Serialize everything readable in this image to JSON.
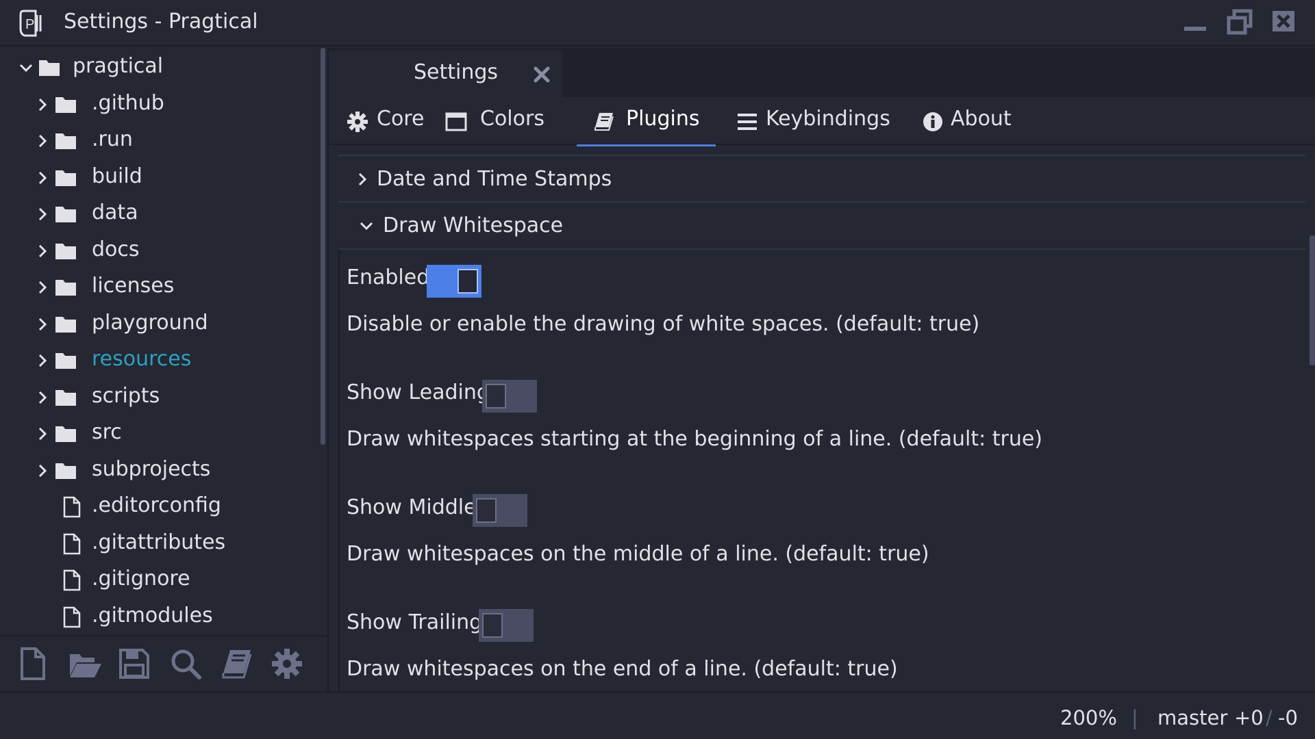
{
  "window": {
    "title": "Settings - Pragtical",
    "logo_text": "P"
  },
  "sidebar": {
    "tree": [
      {
        "label": "pragtical",
        "type": "folder",
        "expanded": true,
        "depth": 0
      },
      {
        "label": ".github",
        "type": "folder",
        "expanded": false,
        "depth": 1
      },
      {
        "label": ".run",
        "type": "folder",
        "expanded": false,
        "depth": 1
      },
      {
        "label": "build",
        "type": "folder",
        "expanded": false,
        "depth": 1
      },
      {
        "label": "data",
        "type": "folder",
        "expanded": false,
        "depth": 1
      },
      {
        "label": "docs",
        "type": "folder",
        "expanded": false,
        "depth": 1
      },
      {
        "label": "licenses",
        "type": "folder",
        "expanded": false,
        "depth": 1
      },
      {
        "label": "playground",
        "type": "folder",
        "expanded": false,
        "depth": 1
      },
      {
        "label": "resources",
        "type": "folder",
        "expanded": false,
        "depth": 1,
        "highlight": true
      },
      {
        "label": "scripts",
        "type": "folder",
        "expanded": false,
        "depth": 1
      },
      {
        "label": "src",
        "type": "folder",
        "expanded": false,
        "depth": 1
      },
      {
        "label": "subprojects",
        "type": "folder",
        "expanded": false,
        "depth": 1
      },
      {
        "label": ".editorconfig",
        "type": "file",
        "depth": 1
      },
      {
        "label": ".gitattributes",
        "type": "file",
        "depth": 1
      },
      {
        "label": ".gitignore",
        "type": "file",
        "depth": 1
      },
      {
        "label": ".gitmodules",
        "type": "file",
        "depth": 1
      }
    ],
    "toolbar": [
      "new-file-icon",
      "open-folder-icon",
      "save-icon",
      "search-icon",
      "book-icon",
      "gear-icon"
    ]
  },
  "doc_tab": {
    "label": "Settings",
    "close_icon": "close-icon"
  },
  "settings_tabs": [
    {
      "label": "Core",
      "icon": "gear-icon",
      "active": false
    },
    {
      "label": "Colors",
      "icon": "window-icon",
      "active": false
    },
    {
      "label": "Plugins",
      "icon": "book-icon",
      "active": true
    },
    {
      "label": "Keybindings",
      "icon": "menu-icon",
      "active": false
    },
    {
      "label": "About",
      "icon": "info-icon",
      "active": false
    }
  ],
  "sections": {
    "date_time": {
      "title": "Date and Time Stamps",
      "expanded": false
    },
    "draw_whitespace": {
      "title": "Draw Whitespace",
      "expanded": true
    }
  },
  "options": [
    {
      "label": "Enabled",
      "enabled": true,
      "description": "Disable or enable the drawing of white spaces. (default: true)"
    },
    {
      "label": "Show Leading",
      "enabled": false,
      "description": "Draw whitespaces starting at the beginning of a line. (default: true)"
    },
    {
      "label": "Show Middle",
      "enabled": false,
      "description": "Draw whitespaces on the middle of a line. (default: true)"
    },
    {
      "label": "Show Trailing",
      "enabled": false,
      "description": "Draw whitespaces on the end of a line. (default: true)"
    }
  ],
  "statusbar": {
    "zoom": "200%",
    "separator": "|",
    "branch": "master",
    "added": "+0",
    "slash": "/",
    "removed": "-0"
  },
  "colors": {
    "accent": "#4d7fe8",
    "highlight_folder": "#2e9fbf",
    "background": "#252733",
    "text": "#e1e1e6"
  }
}
